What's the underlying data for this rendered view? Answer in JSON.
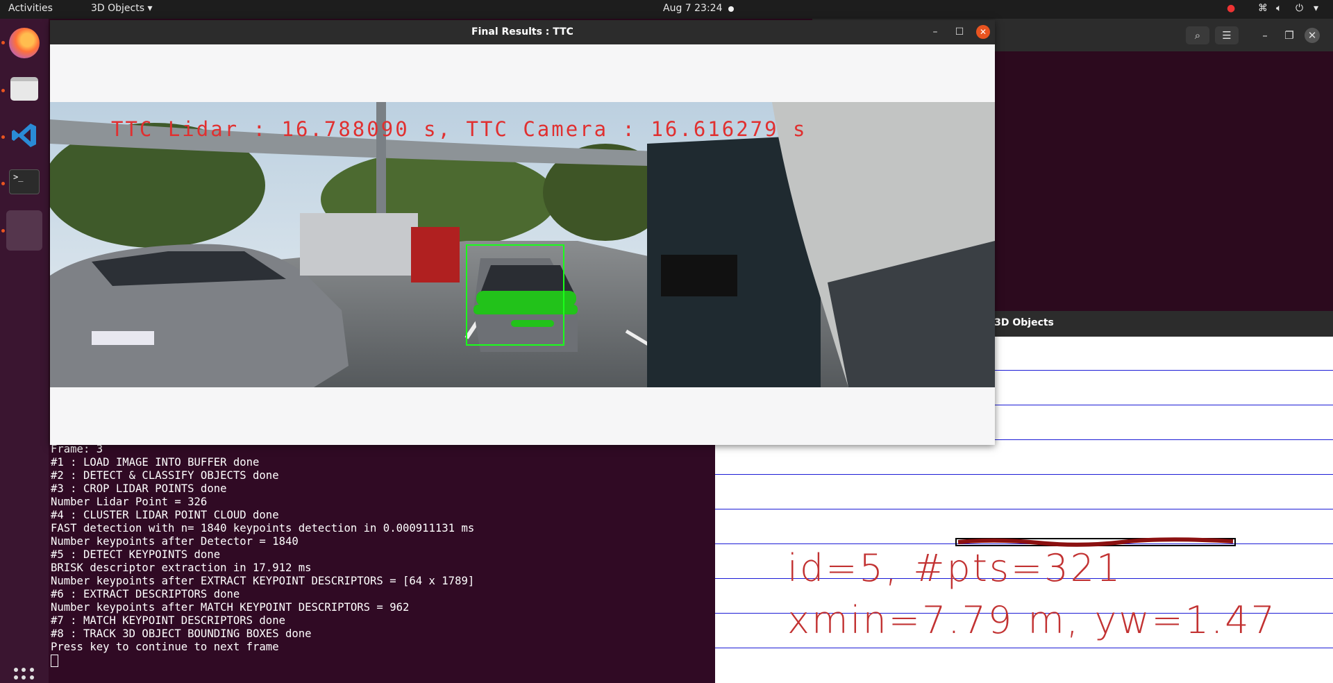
{
  "topbar": {
    "activities": "Activities",
    "app_menu": "3D Objects",
    "clock": "Aug 7  23:24"
  },
  "main_window": {
    "title": "Final Results : TTC",
    "overlay_text": "TTC Lidar : 16.788090 s, TTC Camera : 16.616279 s"
  },
  "objects_window": {
    "title": "3D Objects",
    "label_line1": "id=5, #pts=321",
    "label_line2": "xmin=7.79 m, yw=1.47"
  },
  "terminal": {
    "lines": [
      "Frame: 3",
      "#1 : LOAD IMAGE INTO BUFFER done",
      "#2 : DETECT & CLASSIFY OBJECTS done",
      "#3 : CROP LIDAR POINTS done",
      "Number Lidar Point = 326",
      "#4 : CLUSTER LIDAR POINT CLOUD done",
      "FAST detection with n= 1840 keypoints detection in 0.000911131 ms",
      "Number keypoints after Detector = 1840",
      "#5 : DETECT KEYPOINTS done",
      "BRISK descriptor extraction in 17.912 ms",
      "Number keypoints after EXTRACT KEYPOINT DESCRIPTORS = [64 x 1789]",
      "#6 : EXTRACT DESCRIPTORS done",
      "Number keypoints after MATCH KEYPOINT DESCRIPTORS = 962",
      "#7 : MATCH KEYPOINT DESCRIPTORS done",
      "#8 : TRACK 3D OBJECT BOUNDING BOXES done",
      "Press key to continue to next frame"
    ]
  },
  "dock": [
    "firefox-icon",
    "files-icon",
    "vscode-icon",
    "terminal-icon",
    "3d-objects-app-icon",
    "show-apps-icon"
  ],
  "colors": {
    "accent": "#e95420",
    "terminal_bg": "#300a24",
    "overlay_red": "#e03030",
    "bbox_green": "#1aff1a",
    "grid_blue": "#1b1bd6"
  }
}
